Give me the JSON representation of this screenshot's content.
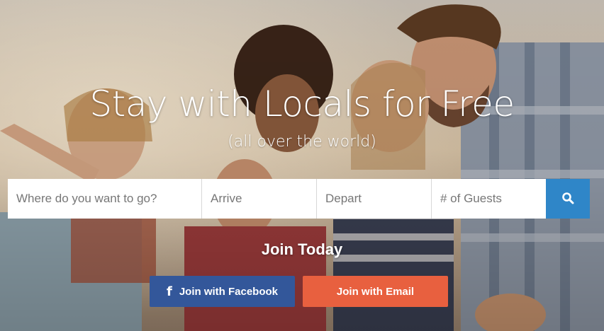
{
  "hero": {
    "headline": "Stay with Locals for Free",
    "subheadline": "(all over the world)"
  },
  "search": {
    "where_placeholder": "Where do you want to go?",
    "arrive_placeholder": "Arrive",
    "depart_placeholder": "Depart",
    "guests_placeholder": "# of Guests",
    "button_icon": "search-icon"
  },
  "join": {
    "title": "Join Today",
    "facebook_label": "Join with Facebook",
    "facebook_icon": "facebook-icon",
    "email_label": "Join with Email"
  },
  "colors": {
    "search_button": "#2f86c8",
    "facebook_button": "#33579a",
    "email_button": "#e8603f"
  }
}
